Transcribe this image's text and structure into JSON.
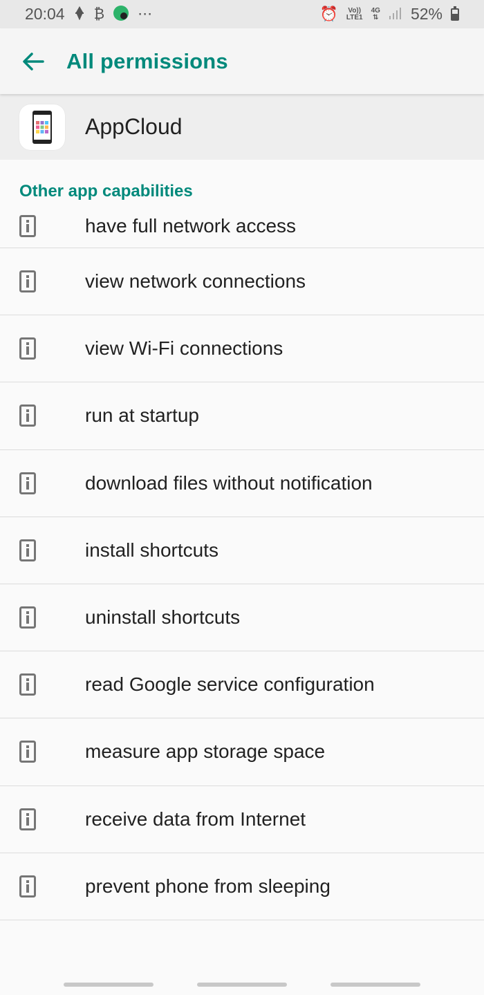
{
  "status_bar": {
    "time": "20:04",
    "volte_top": "Vo))",
    "volte_bottom": "LTE1",
    "network": "4G",
    "battery": "52%"
  },
  "app_bar": {
    "title": "All permissions"
  },
  "app": {
    "name": "AppCloud"
  },
  "section": {
    "title": "Other app capabilities"
  },
  "permissions": [
    "have full network access",
    "view network connections",
    "view Wi-Fi connections",
    "run at startup",
    "download files without notification",
    "install shortcuts",
    "uninstall shortcuts",
    "read Google service configuration",
    "measure app storage space",
    "receive data from Internet",
    "prevent phone from sleeping"
  ],
  "colors": {
    "accent": "#00897b",
    "icon": "#757575"
  }
}
